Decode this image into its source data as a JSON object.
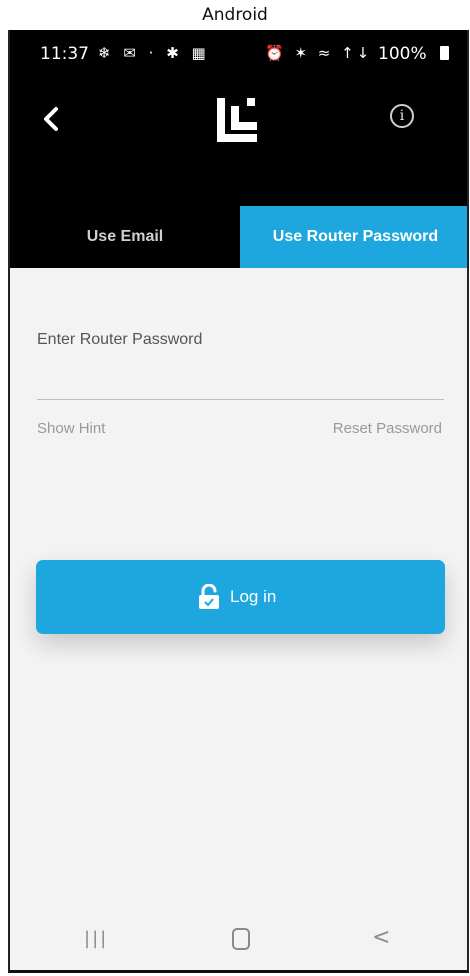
{
  "caption": "Android",
  "status_bar": {
    "time": "11:37",
    "left_icons": "❄ ✉ · ✱ ▦",
    "right_icons": "⏰ ✶ ≈ ↑↓",
    "battery": "100%"
  },
  "tabs": {
    "email": "Use Email",
    "router": "Use Router Password"
  },
  "form": {
    "label": "Enter Router Password",
    "value": "",
    "show_hint": "Show Hint",
    "reset_password": "Reset Password"
  },
  "login_button": {
    "label": "Log in"
  },
  "nav_bar": {
    "recent_icon": "recent-apps-icon",
    "home_icon": "home-icon",
    "back_icon": "back-icon"
  },
  "colors": {
    "accent": "#1ea7de",
    "header_bg": "#000000",
    "content_bg": "#f3f3f3"
  }
}
